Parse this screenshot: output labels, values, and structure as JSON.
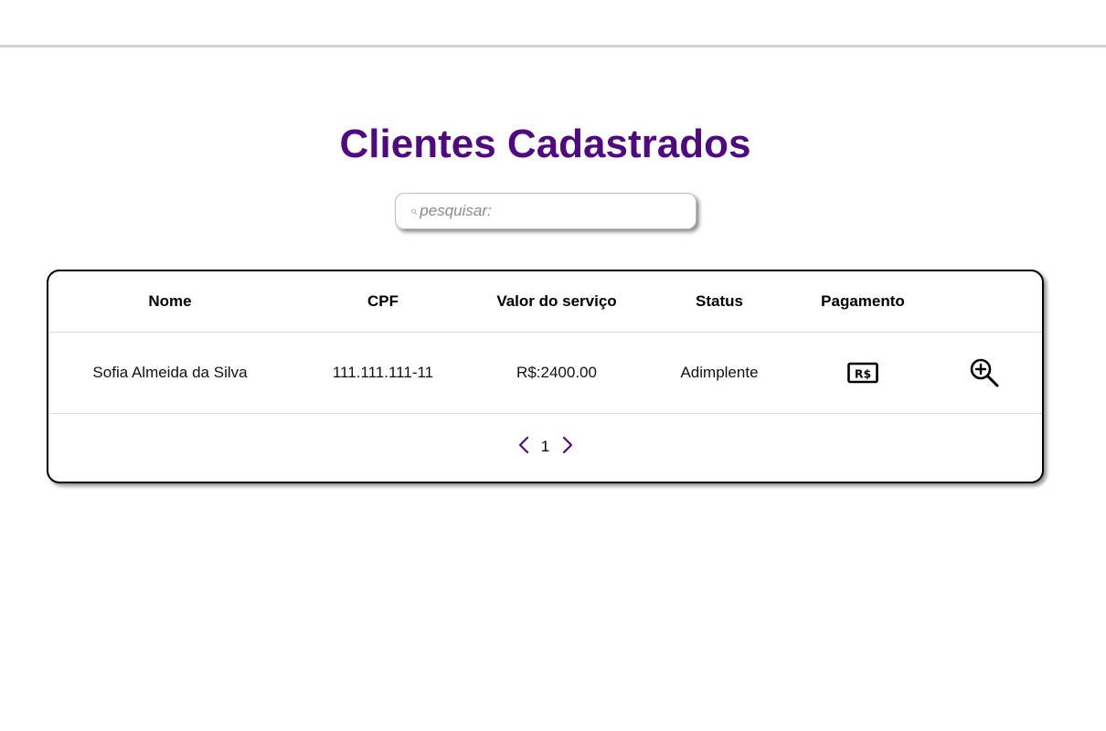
{
  "header": {
    "title": "Clientes Cadastrados"
  },
  "search": {
    "placeholder": "pesquisar:",
    "value": "",
    "icon": "search-icon"
  },
  "table": {
    "columns": [
      "Nome",
      "CPF",
      "Valor do serviço",
      "Status",
      "Pagamento",
      ""
    ],
    "rows": [
      {
        "nome": "Sofia Almeida da Silva",
        "cpf": "111.111.111-11",
        "valor": "R$:2400.00",
        "status": "Adimplente",
        "payment_icon": "payment-icon",
        "details_icon": "zoom-in-icon"
      }
    ]
  },
  "pagination": {
    "current_page": "1",
    "prev_icon": "chevron-left-icon",
    "next_icon": "chevron-right-icon"
  },
  "colors": {
    "accent": "#500a80",
    "border": "#000000",
    "divider": "#dcdcdc"
  }
}
